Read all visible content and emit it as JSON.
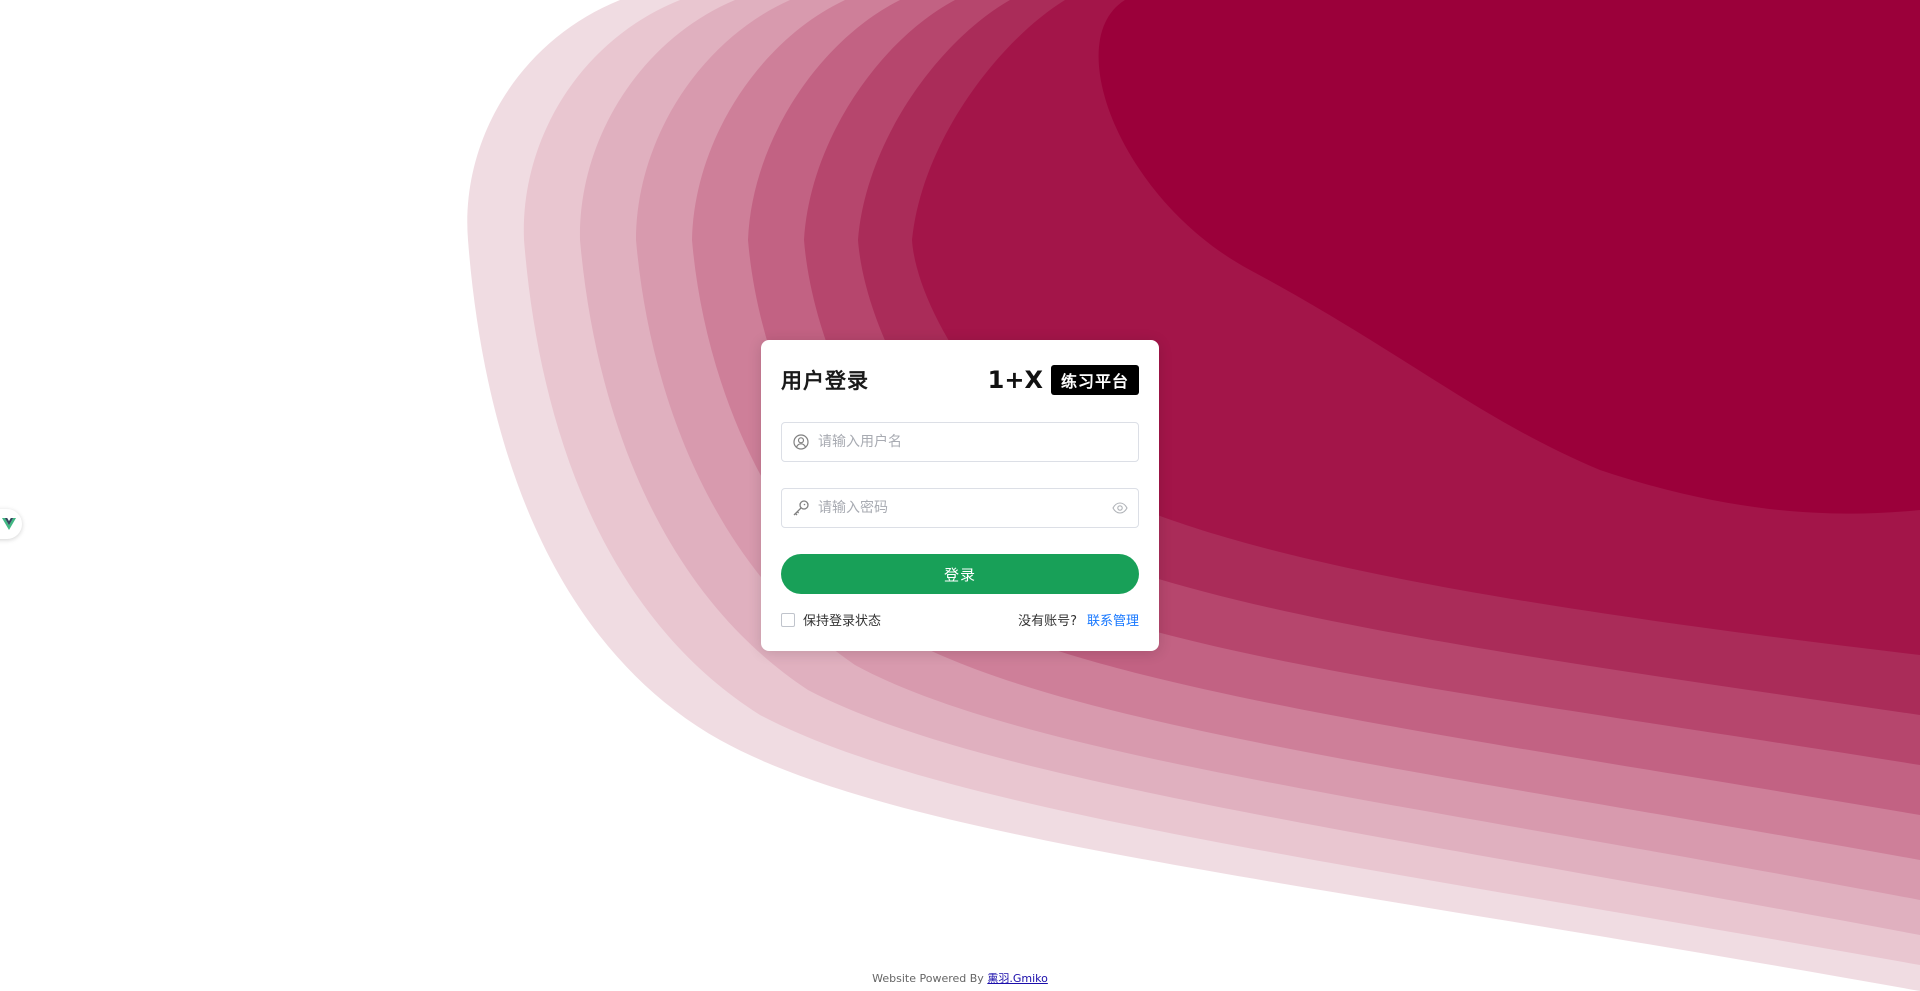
{
  "login": {
    "title": "用户登录",
    "brand_mark": "1+X",
    "brand_badge": "练习平台",
    "username_placeholder": "请输入用户名",
    "password_placeholder": "请输入密码",
    "login_label": "登录",
    "remember_label": "保持登录状态",
    "no_account_text": "没有账号?",
    "contact_label": "联系管理"
  },
  "footer": {
    "powered_text": "Website Powered By",
    "powered_link": "熏羽.Gmiko"
  },
  "icons": {
    "side_toggle": "vue-logo-icon",
    "username_prefix": "user-circle-icon",
    "password_prefix": "key-icon",
    "password_suffix": "eye-icon"
  },
  "colors": {
    "accent_button": "#18a058",
    "link": "#1677ff",
    "wave_darkest": "#9b003a",
    "wave_lightest": "#f0dce2"
  }
}
